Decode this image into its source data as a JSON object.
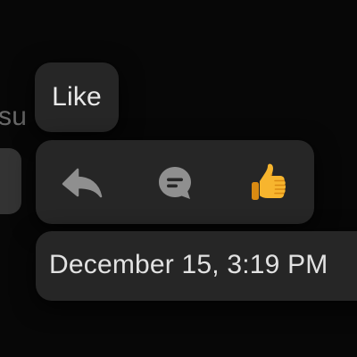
{
  "background": {
    "fragment_text": "su"
  },
  "tooltip": {
    "label": "Like"
  },
  "actions": [
    {
      "name": "reply",
      "icon": "reply-arrow-icon"
    },
    {
      "name": "comment",
      "icon": "comment-bubble-icon"
    },
    {
      "name": "like",
      "icon": "thumbs-up-icon"
    }
  ],
  "timestamp": {
    "text": "December 15, 3:19 PM"
  },
  "colors": {
    "background": "#070707",
    "panel": "#262626",
    "icon_gray": "#8f8f8f",
    "thumb_yellow": "#f7b52e",
    "text": "#e9e9e9"
  }
}
